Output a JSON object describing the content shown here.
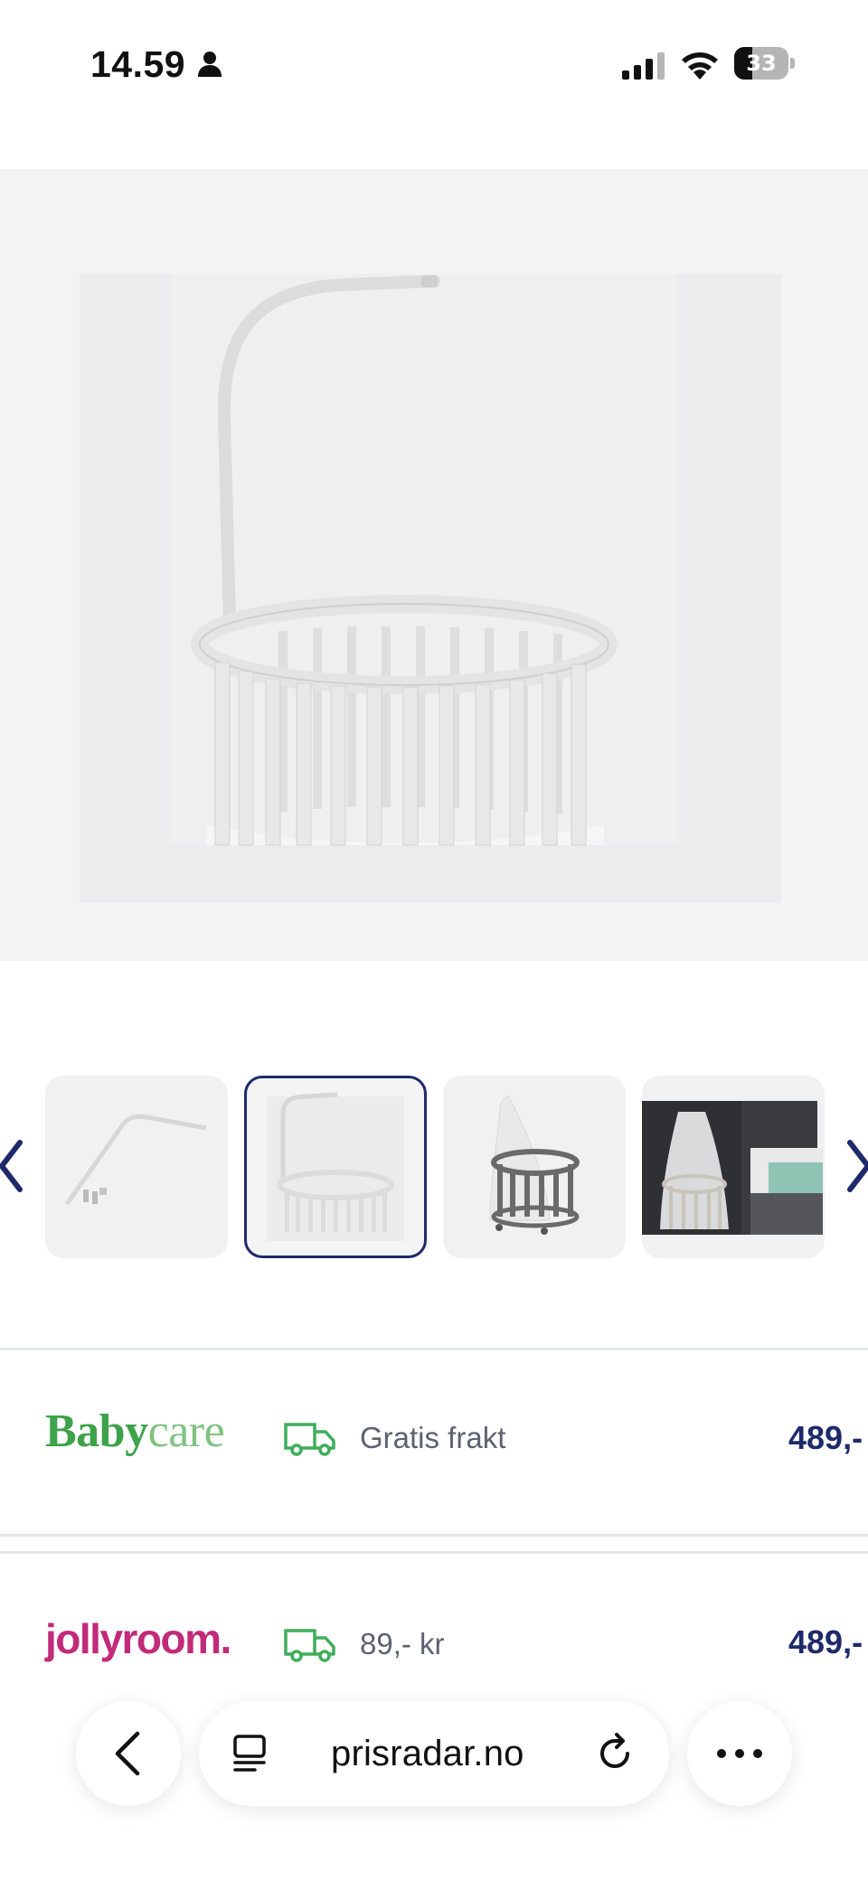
{
  "status_bar": {
    "time": "14.59",
    "battery_level": "33",
    "battery_fraction": 0.33,
    "icons": [
      "person-icon",
      "signal-icon",
      "wifi-icon",
      "battery-icon"
    ]
  },
  "gallery": {
    "main_image_alt": "crib-canopy-rod-on-round-crib",
    "thumbnails": [
      {
        "name": "canopy-rod-parts"
      },
      {
        "name": "white-round-crib-with-rod",
        "selected": true
      },
      {
        "name": "grey-crib-with-canopy"
      },
      {
        "name": "crib-in-bedroom"
      }
    ],
    "prev_icon": "chevron-left-icon",
    "next_icon": "chevron-right-icon"
  },
  "offers": [
    {
      "store": {
        "part1": "Baby",
        "part2": "care"
      },
      "shipping": "Gratis frakt",
      "price": "489,-",
      "icon": "truck-icon"
    },
    {
      "store": {
        "part1": "jollyroom."
      },
      "shipping": "89,- kr",
      "price": "489,-",
      "icon": "truck-icon"
    }
  ],
  "browser": {
    "url": "prisradar.no",
    "icons": [
      "back-chevron-icon",
      "tab-list-icon",
      "reload-icon",
      "more-icon"
    ]
  },
  "colors": {
    "brand_navy": "#1f2a6b",
    "babycare_green": "#3ea24a",
    "jollyroom_pink": "#c22a7a",
    "truck_green": "#3fae5a"
  }
}
